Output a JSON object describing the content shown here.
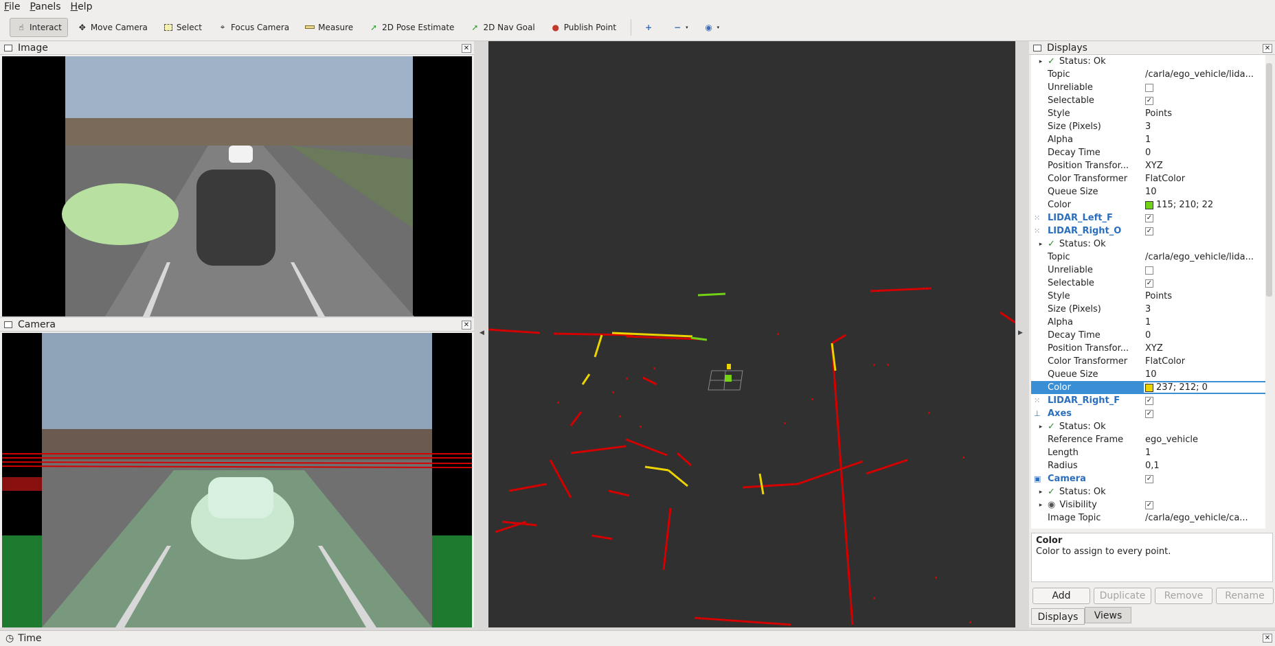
{
  "menu": [
    "File",
    "Panels",
    "Help"
  ],
  "toolbar": {
    "tools": [
      {
        "label": "Interact",
        "icon": "hand-pointer-icon",
        "active": true
      },
      {
        "label": "Move Camera",
        "icon": "move-camera-icon"
      },
      {
        "label": "Select",
        "icon": "select-box-icon"
      },
      {
        "label": "Focus Camera",
        "icon": "focus-crosshair-icon"
      },
      {
        "label": "Measure",
        "icon": "ruler-icon"
      },
      {
        "label": "2D Pose Estimate",
        "icon": "green-arrow-icon"
      },
      {
        "label": "2D Nav Goal",
        "icon": "green-arrow-icon"
      },
      {
        "label": "Publish Point",
        "icon": "map-pin-icon"
      }
    ]
  },
  "panels": {
    "image_title": "Image",
    "camera_title": "Camera",
    "displays_title": "Displays",
    "close_glyph": "✕"
  },
  "displays": {
    "rows": [
      {
        "k": "status",
        "c1": "Status: Ok",
        "indent": 1
      },
      {
        "k": "prop",
        "c1": "Topic",
        "c2": "/carla/ego_vehicle/lida...",
        "indent": 2
      },
      {
        "k": "cb",
        "c1": "Unreliable",
        "checked": false,
        "indent": 2
      },
      {
        "k": "cb",
        "c1": "Selectable",
        "checked": true,
        "indent": 2
      },
      {
        "k": "prop",
        "c1": "Style",
        "c2": "Points",
        "indent": 2
      },
      {
        "k": "prop",
        "c1": "Size (Pixels)",
        "c2": "3",
        "indent": 2
      },
      {
        "k": "prop",
        "c1": "Alpha",
        "c2": "1",
        "indent": 2
      },
      {
        "k": "prop",
        "c1": "Decay Time",
        "c2": "0",
        "indent": 2
      },
      {
        "k": "prop",
        "c1": "Position Transfor...",
        "c2": "XYZ",
        "indent": 2
      },
      {
        "k": "prop",
        "c1": "Color Transformer",
        "c2": "FlatColor",
        "indent": 2
      },
      {
        "k": "prop",
        "c1": "Queue Size",
        "c2": "10",
        "indent": 2
      },
      {
        "k": "color",
        "c1": "Color",
        "c2": "115; 210; 22",
        "swatch": "#73d216",
        "indent": 2
      },
      {
        "k": "display",
        "c1": "LIDAR_Left_F",
        "checked": true,
        "icon": "pointcloud-icon"
      },
      {
        "k": "display",
        "c1": "LIDAR_Right_O",
        "checked": true,
        "icon": "pointcloud-icon"
      },
      {
        "k": "status",
        "c1": "Status: Ok",
        "indent": 1
      },
      {
        "k": "prop",
        "c1": "Topic",
        "c2": "/carla/ego_vehicle/lida...",
        "indent": 2
      },
      {
        "k": "cb",
        "c1": "Unreliable",
        "checked": false,
        "indent": 2
      },
      {
        "k": "cb",
        "c1": "Selectable",
        "checked": true,
        "indent": 2
      },
      {
        "k": "prop",
        "c1": "Style",
        "c2": "Points",
        "indent": 2
      },
      {
        "k": "prop",
        "c1": "Size (Pixels)",
        "c2": "3",
        "indent": 2
      },
      {
        "k": "prop",
        "c1": "Alpha",
        "c2": "1",
        "indent": 2
      },
      {
        "k": "prop",
        "c1": "Decay Time",
        "c2": "0",
        "indent": 2
      },
      {
        "k": "prop",
        "c1": "Position Transfor...",
        "c2": "XYZ",
        "indent": 2
      },
      {
        "k": "prop",
        "c1": "Color Transformer",
        "c2": "FlatColor",
        "indent": 2
      },
      {
        "k": "prop",
        "c1": "Queue Size",
        "c2": "10",
        "indent": 2
      },
      {
        "k": "color",
        "c1": "Color",
        "c2": "237; 212; 0",
        "swatch": "#edd400",
        "indent": 2,
        "selected": true
      },
      {
        "k": "display",
        "c1": "LIDAR_Right_F",
        "checked": true,
        "icon": "pointcloud-icon"
      },
      {
        "k": "display",
        "c1": "Axes",
        "checked": true,
        "icon": "axes-icon"
      },
      {
        "k": "status",
        "c1": "Status: Ok",
        "indent": 1
      },
      {
        "k": "prop",
        "c1": "Reference Frame",
        "c2": "ego_vehicle",
        "indent": 2
      },
      {
        "k": "prop",
        "c1": "Length",
        "c2": "1",
        "indent": 2
      },
      {
        "k": "prop",
        "c1": "Radius",
        "c2": "0,1",
        "indent": 2
      },
      {
        "k": "display",
        "c1": "Camera",
        "checked": true,
        "icon": "camera-icon"
      },
      {
        "k": "status",
        "c1": "Status: Ok",
        "indent": 1
      },
      {
        "k": "vis",
        "c1": "Visibility",
        "checked": true,
        "indent": 1
      },
      {
        "k": "prop",
        "c1": "Image Topic",
        "c2": "/carla/ego_vehicle/ca...",
        "indent": 2
      }
    ]
  },
  "description": {
    "title": "Color",
    "text": "Color to assign to every point."
  },
  "buttons": {
    "add": "Add",
    "duplicate": "Duplicate",
    "remove": "Remove",
    "rename": "Rename"
  },
  "tabs": {
    "displays": "Displays",
    "views": "Views"
  },
  "time": "Time",
  "colors": {
    "accent": "#3a8ed3",
    "lidar_red": "#d40000",
    "lidar_yellow": "#edd400",
    "lidar_green": "#73d216"
  }
}
